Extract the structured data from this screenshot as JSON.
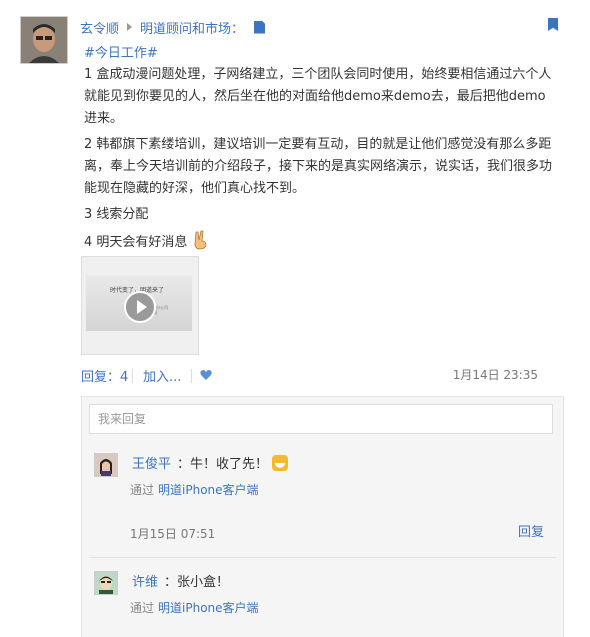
{
  "post": {
    "author": "玄令顺",
    "group": "明道顾问和市场：",
    "tag": "#今日工作#",
    "paragraphs": [
      "1 盒成动漫问题处理，子网络建立，三个团队会同时使用，始终要相信通过六个人就能见到你要见的人，然后坐在他的对面给他demo来demo去，最后把他demo进来。",
      "2 韩都旗下素缕培训，建议培训一定要有互动，目的就是让他们感觉没有那么多距离，奉上今天培训前的介绍段子，接下来的是真实网络演示，说实话，我们很多功能现在隐藏的好深，他们真心找不到。",
      "3 线索分配",
      "4 明天会有好消息"
    ],
    "video_thumb": {
      "line1": "时代变了，明道来了",
      "line2": "明道精英分公司",
      "line3": "— 玄令顺"
    },
    "actions": {
      "reply_label": "回复：4",
      "add_label": "加入...",
      "timestamp": "1月14日 23:35"
    }
  },
  "comments": {
    "placeholder": "我来回复",
    "items": [
      {
        "name": "王俊平",
        "message": "：牛！收了先！",
        "via_label": "通过",
        "source": "明道iPhone客户端",
        "date": "1月15日 07:51",
        "reply_label": "回复"
      },
      {
        "name": "许维",
        "message": "：张小盒！",
        "via_label": "通过",
        "source": "明道iPhone客户端"
      }
    ]
  },
  "colors": {
    "link": "#3b74c1",
    "text": "#333333",
    "muted": "#777777"
  }
}
